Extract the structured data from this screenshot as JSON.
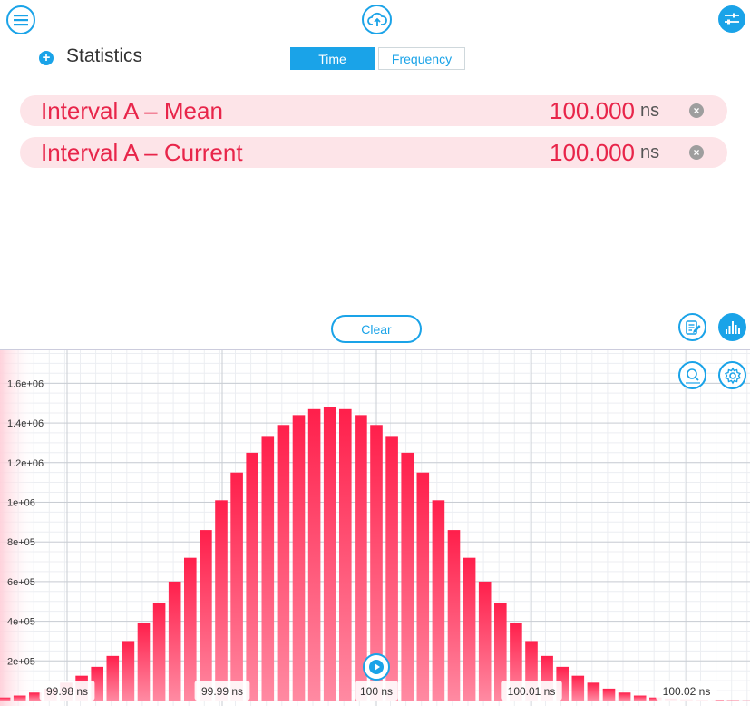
{
  "header": {
    "menu_icon": "menu-icon",
    "cloud_icon": "cloud-upload-icon",
    "settings_icon": "sliders-icon"
  },
  "statistics": {
    "title": "Statistics",
    "expand_icon": "plus-icon",
    "rows": [
      {
        "label": "Interval A – Mean",
        "value": "100.000",
        "unit": "ns"
      },
      {
        "label": "Interval A – Current",
        "value": "100.000",
        "unit": "ns"
      }
    ]
  },
  "mode_tabs": {
    "time": "Time",
    "frequency": "Frequency",
    "selected": "Time"
  },
  "controls": {
    "clear_label": "Clear",
    "notes_icon": "edit-notes-icon",
    "histogram_icon": "histogram-icon",
    "zoom_icon": "zoom-icon",
    "chart_settings_icon": "gear-icon",
    "play_icon": "play-icon"
  },
  "colors": {
    "accent": "#1aa3e8",
    "data": "#ff1f4b",
    "row_bg": "#fde4e8"
  },
  "chart_data": {
    "type": "bar",
    "x": [
      99.975,
      99.976,
      99.977,
      99.978,
      99.979,
      99.98,
      99.981,
      99.982,
      99.983,
      99.984,
      99.985,
      99.986,
      99.987,
      99.988,
      99.989,
      99.99,
      99.991,
      99.992,
      99.993,
      99.994,
      99.995,
      99.996,
      99.997,
      99.998,
      99.999,
      100.0,
      100.001,
      100.002,
      100.003,
      100.004,
      100.005,
      100.006,
      100.007,
      100.008,
      100.009,
      100.01,
      100.011,
      100.012,
      100.013,
      100.014,
      100.015,
      100.016,
      100.017,
      100.018,
      100.019,
      100.02,
      100.021,
      100.022,
      100.023,
      100.024,
      100.025
    ],
    "values": [
      10000,
      15000,
      25000,
      40000,
      60000,
      90000,
      125000,
      170000,
      225000,
      300000,
      390000,
      490000,
      600000,
      720000,
      860000,
      1010000,
      1150000,
      1250000,
      1330000,
      1390000,
      1440000,
      1470000,
      1480000,
      1470000,
      1440000,
      1390000,
      1330000,
      1250000,
      1150000,
      1010000,
      860000,
      720000,
      600000,
      490000,
      390000,
      300000,
      225000,
      170000,
      125000,
      90000,
      60000,
      40000,
      25000,
      15000,
      10000,
      6000,
      4000,
      2500,
      1500,
      800,
      400
    ],
    "y_ticks": [
      "2e+05",
      "4e+05",
      "6e+05",
      "8e+05",
      "1e+06",
      "1.2e+06",
      "1.4e+06",
      "1.6e+06"
    ],
    "x_ticks": [
      "99.98 ns",
      "99.99 ns",
      "100 ns",
      "100.01 ns",
      "100.02 ns"
    ],
    "xlim": [
      99.97,
      100.026
    ],
    "ylim": [
      0,
      1750000
    ],
    "grid": true
  }
}
